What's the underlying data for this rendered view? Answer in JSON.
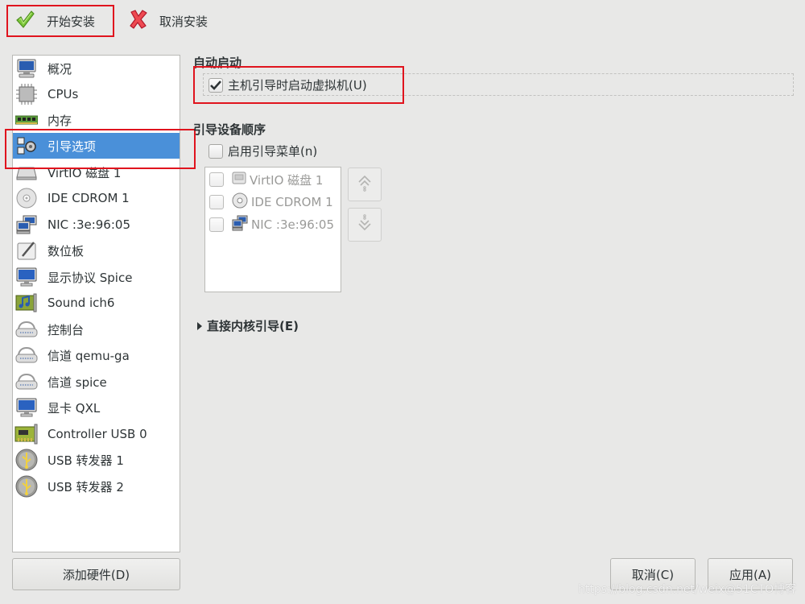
{
  "toolbar": {
    "install_label": "开始安装",
    "install_icon": "checkmark-icon",
    "cancel_install_label": "取消安装",
    "cancel_icon": "x-icon",
    "colors": {
      "check": "#6cbf2a",
      "cross": "#e0303a"
    }
  },
  "sidebar": {
    "items": [
      {
        "label": "概况",
        "icon": "monitor-icon"
      },
      {
        "label": "CPUs",
        "icon": "cpu-icon"
      },
      {
        "label": "内存",
        "icon": "memory-icon"
      },
      {
        "label": "引导选项",
        "icon": "gears-icon",
        "selected": true
      },
      {
        "label": "VirtIO 磁盘 1",
        "icon": "disk-icon"
      },
      {
        "label": "IDE CDROM 1",
        "icon": "cdrom-icon"
      },
      {
        "label": "NIC :3e:96:05",
        "icon": "network-icon"
      },
      {
        "label": "数位板",
        "icon": "tablet-icon"
      },
      {
        "label": "显示协议 Spice",
        "icon": "display-icon"
      },
      {
        "label": "Sound ich6",
        "icon": "sound-card-icon"
      },
      {
        "label": "控制台",
        "icon": "serial-icon"
      },
      {
        "label": "信道 qemu-ga",
        "icon": "serial-icon"
      },
      {
        "label": "信道 spice",
        "icon": "serial-icon"
      },
      {
        "label": "显卡 QXL",
        "icon": "display-icon"
      },
      {
        "label": "Controller USB 0",
        "icon": "pci-card-icon"
      },
      {
        "label": "USB 转发器 1",
        "icon": "usb-icon"
      },
      {
        "label": "USB 转发器 2",
        "icon": "usb-icon"
      }
    ],
    "selected_color": "#4a90d9",
    "add_hardware_label": "添加硬件(D)"
  },
  "main": {
    "autostart": {
      "title": "自动启动",
      "checkbox_label": "主机引导时启动虚拟机(U)",
      "checked": true
    },
    "boot_order": {
      "title": "引导设备顺序",
      "menu_checkbox_label": "启用引导菜单(n)",
      "menu_checked": false,
      "devices": [
        {
          "label": "VirtIO 磁盘 1",
          "icon": "disk-icon",
          "checked": false
        },
        {
          "label": "IDE CDROM 1",
          "icon": "cdrom-icon",
          "checked": false
        },
        {
          "label": "NIC :3e:96:05",
          "icon": "network-icon",
          "checked": false
        }
      ],
      "move_up_icon": "arrow-up-icon",
      "move_down_icon": "arrow-down-icon"
    },
    "direct_kernel": {
      "label": "直接内核引导(E)",
      "expanded": false
    }
  },
  "footer": {
    "cancel_label": "取消(C)",
    "apply_label": "应用(A)"
  },
  "watermark": "https://blog.csdn.net/weix@51CTO博客",
  "highlight_color": "#e0141e"
}
